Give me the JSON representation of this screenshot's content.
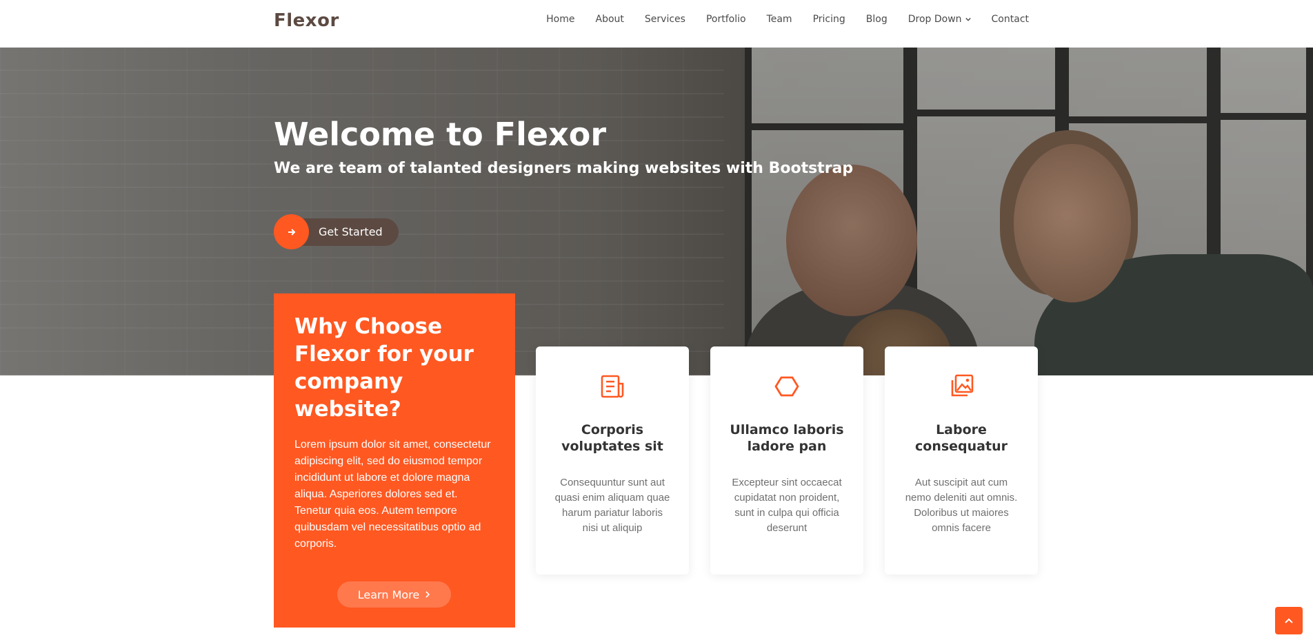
{
  "brand": {
    "name": "Flexor",
    "accent": "#ff5821",
    "dark": "#5c4a42"
  },
  "nav": {
    "items": [
      "Home",
      "About",
      "Services",
      "Portfolio",
      "Team",
      "Pricing",
      "Blog",
      "Drop Down",
      "Contact"
    ],
    "dropdown_icon": "chevron-down-icon"
  },
  "hero": {
    "title": "Welcome to Flexor",
    "subtitle": "We are team of talanted designers making websites with Bootstrap",
    "cta_label": "Get Started",
    "cta_icon": "arrow-right-icon"
  },
  "why": {
    "title": "Why Choose Flexor for your company website?",
    "text": "Lorem ipsum dolor sit amet, consectetur adipiscing elit, sed do eiusmod tempor incididunt ut labore et dolore magna aliqua. Asperiores dolores sed et. Tenetur quia eos. Autem tempore quibusdam vel necessitatibus optio ad corporis.",
    "button_label": "Learn More",
    "button_icon": "chevron-right-icon"
  },
  "cards": [
    {
      "icon": "receipt-icon",
      "title": "Corporis voluptates sit",
      "text": "Consequuntur sunt aut quasi enim aliquam quae harum pariatur laboris nisi ut aliquip"
    },
    {
      "icon": "hexagon-icon",
      "title": "Ullamco laboris ladore pan",
      "text": "Excepteur sint occaecat cupidatat non proident, sunt in culpa qui officia deserunt"
    },
    {
      "icon": "images-icon",
      "title": "Labore consequatur",
      "text": "Aut suscipit aut cum nemo deleniti aut omnis. Doloribus ut maiores omnis facere"
    }
  ],
  "back_to_top": {
    "icon": "arrow-up-icon"
  }
}
